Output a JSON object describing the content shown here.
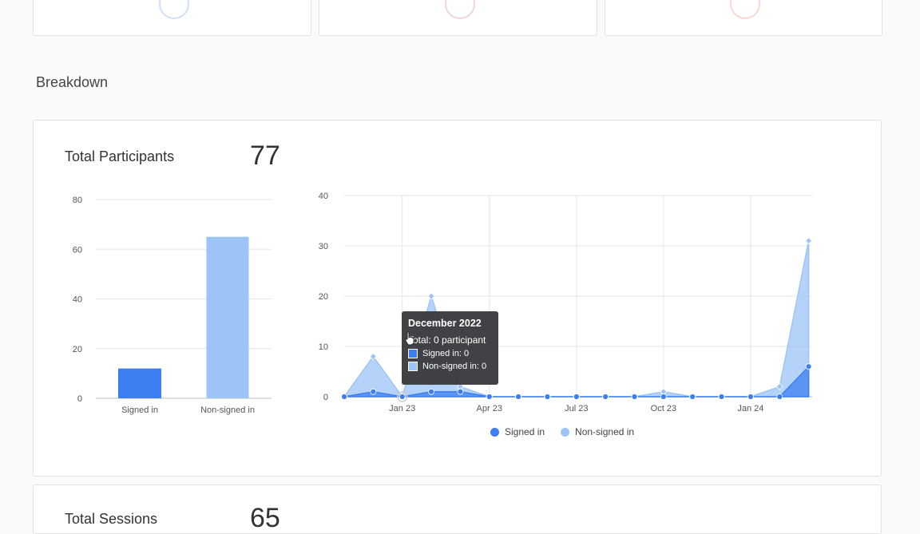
{
  "section_title": "Breakdown",
  "colors": {
    "signed_in": "#3d7ff0",
    "non_signed_in": "#9cc4f5"
  },
  "participants": {
    "label": "Total Participants",
    "value": "77"
  },
  "sessions": {
    "label": "Total Sessions",
    "value": "65"
  },
  "bar_chart": {
    "y_ticks": [
      "80",
      "60",
      "40",
      "20",
      "0"
    ],
    "categories": [
      "Signed in",
      "Non-signed in"
    ]
  },
  "line_chart": {
    "y_ticks": [
      "40",
      "30",
      "20",
      "10",
      "0"
    ],
    "x_ticks": [
      "Jan 23",
      "Apr 23",
      "Jul 23",
      "Oct 23",
      "Jan 24"
    ]
  },
  "legend": {
    "signed_in": "Signed in",
    "non_signed_in": "Non-signed in"
  },
  "tooltip": {
    "title": "December 2022",
    "total": "Total: 0 participant",
    "signed": "Signed in: 0",
    "non_signed": "Non-signed in: 0"
  },
  "chart_data": [
    {
      "type": "bar",
      "categories": [
        "Signed in",
        "Non-signed in"
      ],
      "values": [
        12,
        65
      ],
      "ylim": [
        0,
        80
      ]
    },
    {
      "type": "area",
      "x": [
        "Nov 22",
        "Dec 22",
        "Jan 23",
        "Feb 23",
        "Mar 23",
        "Apr 23",
        "May 23",
        "Jun 23",
        "Jul 23",
        "Aug 23",
        "Sep 23",
        "Oct 23",
        "Nov 23",
        "Dec 23",
        "Jan 24",
        "Feb 24",
        "Mar 24"
      ],
      "series": [
        {
          "name": "Signed in",
          "values": [
            0,
            1,
            0,
            1,
            1,
            0,
            0,
            0,
            0,
            0,
            0,
            0,
            0,
            0,
            0,
            0,
            6
          ]
        },
        {
          "name": "Non-signed in",
          "values": [
            0,
            8,
            0,
            20,
            2,
            0,
            0,
            0,
            0,
            0,
            0,
            1,
            0,
            0,
            0,
            2,
            31
          ]
        }
      ],
      "ylim": [
        0,
        40
      ]
    }
  ]
}
